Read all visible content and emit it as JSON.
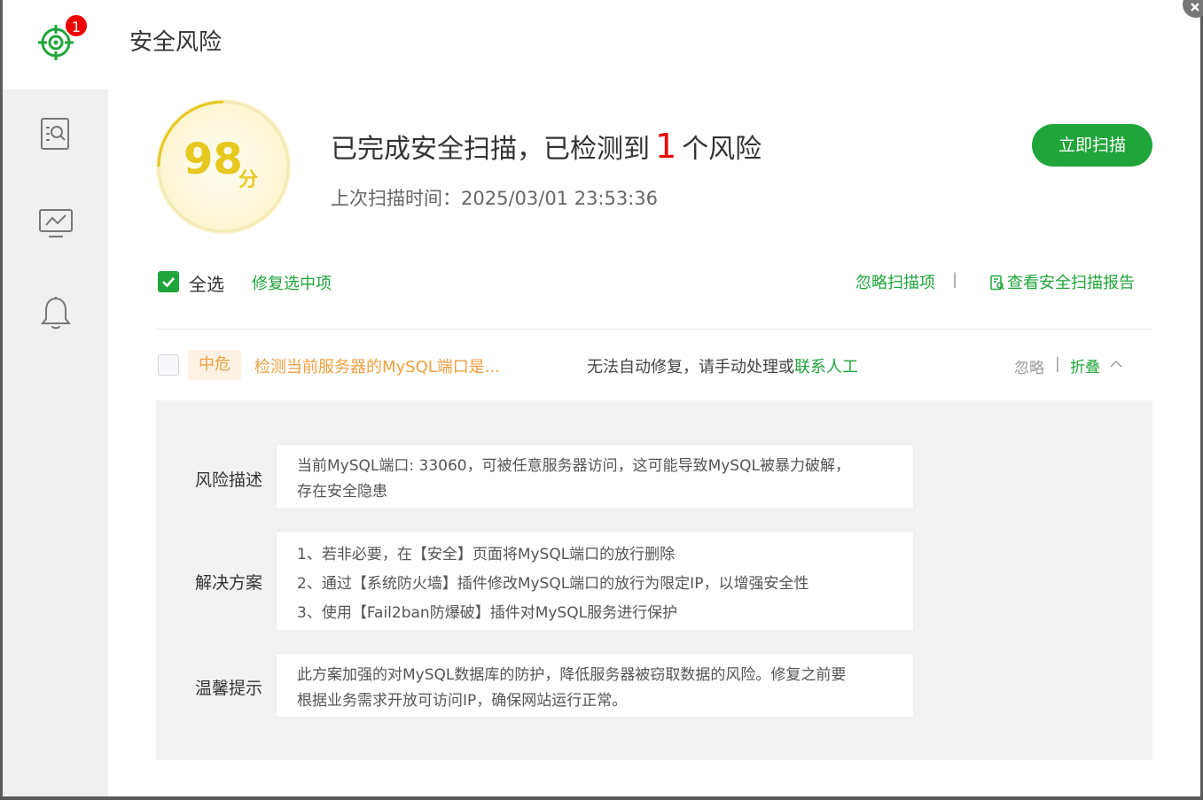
{
  "window": {
    "title": "安全风险",
    "logo_badge": "1"
  },
  "sidebar": {
    "items": [
      {
        "icon": "scan-report-icon"
      },
      {
        "icon": "monitor-icon"
      },
      {
        "icon": "bell-icon"
      }
    ]
  },
  "score": {
    "value": "98",
    "unit": "分"
  },
  "summary": {
    "headline_prefix": "已完成安全扫描，已检测到",
    "risk_count": "1",
    "headline_suffix": "个风险",
    "last_scan": "上次扫描时间：2025/03/01 23:53:36",
    "scan_button": "立即扫描"
  },
  "toolbar": {
    "select_all": "全选",
    "fix_selected": "修复选中项",
    "ignore_items": "忽略扫描项",
    "divider": "|",
    "view_report": "查看安全扫描报告"
  },
  "risk": {
    "level": "中危",
    "title": "检测当前服务器的MySQL端口是...",
    "status_text": "无法自动修复，请手动处理或",
    "contact_link": "联系人工",
    "ignore": "忽略",
    "divider": "|",
    "collapse": "折叠"
  },
  "details": {
    "description_label": "风险描述",
    "description_lines": [
      "当前MySQL端口: 33060，可被任意服务器访问，这可能导致MySQL被暴力破解，",
      "存在安全隐患"
    ],
    "solution_label": "解决方案",
    "solution_lines": [
      "1、若非必要，在【安全】页面将MySQL端口的放行删除",
      "2、通过【系统防火墙】插件修改MySQL端口的放行为限定IP，以增强安全性",
      "3、使用【Fail2ban防爆破】插件对MySQL服务进行保护"
    ],
    "tip_label": "温馨提示",
    "tip_lines": [
      "此方案加强的对MySQL数据库的防护，降低服务器被窃取数据的风险。修复之前要",
      "根据业务需求开放可访问IP，确保网站运行正常。"
    ]
  },
  "colors": {
    "accent": "#20a53a",
    "danger": "#ef0000",
    "warning": "#f0a040",
    "score": "#e6c81e"
  }
}
